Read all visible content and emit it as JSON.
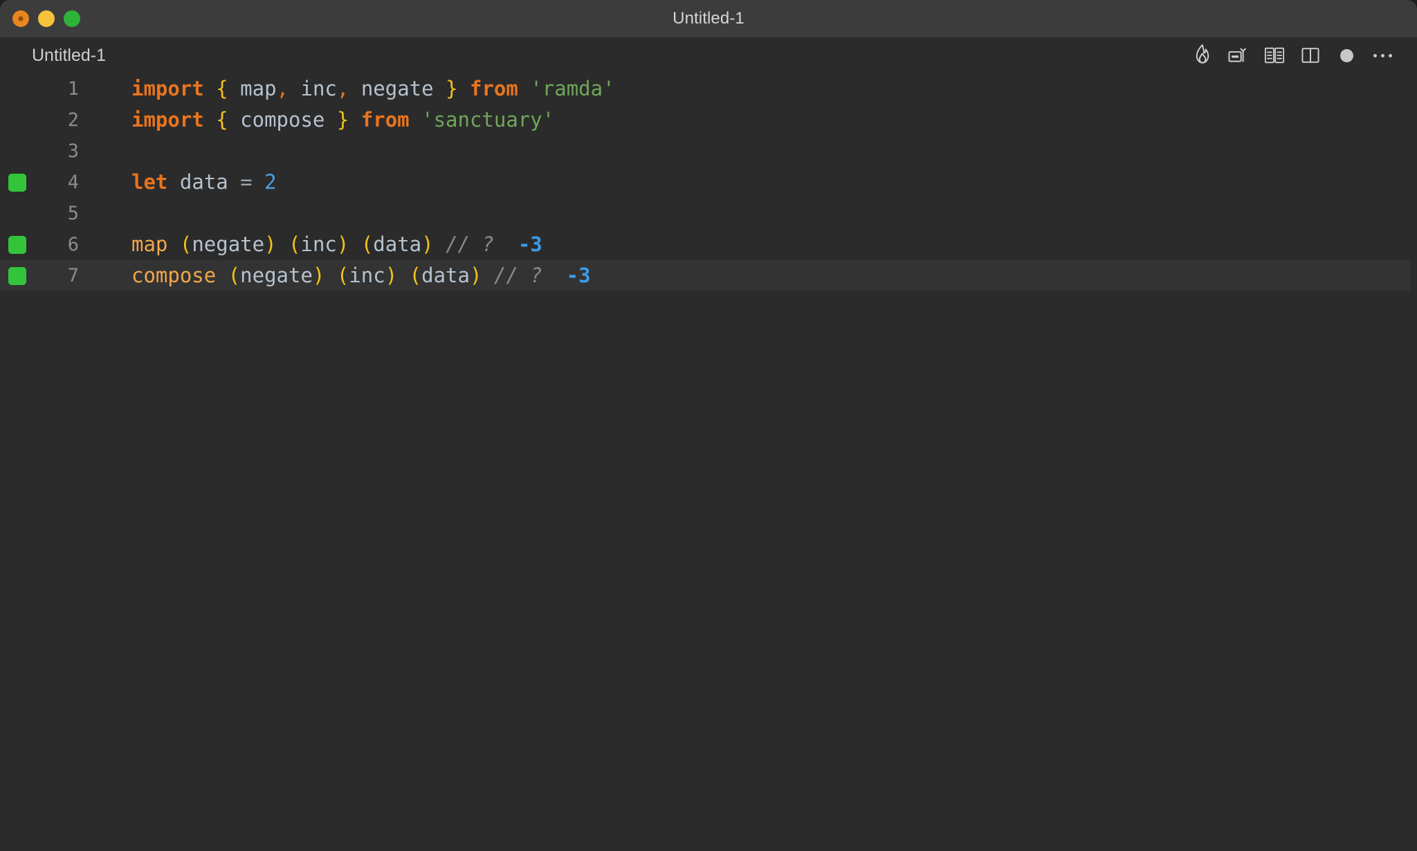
{
  "window": {
    "title": "Untitled-1",
    "traffic_lights": [
      {
        "name": "close",
        "color": "#e8861f"
      },
      {
        "name": "minimize",
        "color": "#f5c33b"
      },
      {
        "name": "maximize",
        "color": "#2eb339"
      }
    ]
  },
  "editor": {
    "tab_title": "Untitled-1",
    "background": "#2b2b2b",
    "active_line_background": "#333333",
    "toolbar": [
      {
        "name": "quokka-flame-icon",
        "label": "Start Quokka"
      },
      {
        "name": "run-code-lens-icon",
        "label": "Run Code"
      },
      {
        "name": "open-book-icon",
        "label": "Open Preview"
      },
      {
        "name": "split-editor-icon",
        "label": "Split Editor Right"
      },
      {
        "name": "unsaved-dot-icon",
        "label": "Unsaved Changes"
      },
      {
        "name": "more-actions-icon",
        "label": "More Actions..."
      }
    ],
    "coverage_marker_color": "#34c43c",
    "lines": [
      {
        "number": "1",
        "marker": false,
        "active": false,
        "tokens": [
          {
            "t": "import",
            "c": "tok-keyword"
          },
          {
            "t": " ",
            "c": "tok-plain"
          },
          {
            "t": "{",
            "c": "tok-brace"
          },
          {
            "t": " ",
            "c": "tok-plain"
          },
          {
            "t": "map",
            "c": "tok-ident"
          },
          {
            "t": ",",
            "c": "tok-punct"
          },
          {
            "t": " ",
            "c": "tok-plain"
          },
          {
            "t": "inc",
            "c": "tok-ident"
          },
          {
            "t": ",",
            "c": "tok-punct"
          },
          {
            "t": " ",
            "c": "tok-plain"
          },
          {
            "t": "negate",
            "c": "tok-ident"
          },
          {
            "t": " ",
            "c": "tok-plain"
          },
          {
            "t": "}",
            "c": "tok-brace"
          },
          {
            "t": " ",
            "c": "tok-plain"
          },
          {
            "t": "from",
            "c": "tok-keyword"
          },
          {
            "t": " ",
            "c": "tok-plain"
          },
          {
            "t": "'ramda'",
            "c": "tok-string"
          }
        ]
      },
      {
        "number": "2",
        "marker": false,
        "active": false,
        "tokens": [
          {
            "t": "import",
            "c": "tok-keyword"
          },
          {
            "t": " ",
            "c": "tok-plain"
          },
          {
            "t": "{",
            "c": "tok-brace"
          },
          {
            "t": " ",
            "c": "tok-plain"
          },
          {
            "t": "compose",
            "c": "tok-ident"
          },
          {
            "t": " ",
            "c": "tok-plain"
          },
          {
            "t": "}",
            "c": "tok-brace"
          },
          {
            "t": " ",
            "c": "tok-plain"
          },
          {
            "t": "from",
            "c": "tok-keyword"
          },
          {
            "t": " ",
            "c": "tok-plain"
          },
          {
            "t": "'sanctuary'",
            "c": "tok-string"
          }
        ]
      },
      {
        "number": "3",
        "marker": false,
        "active": false,
        "tokens": []
      },
      {
        "number": "4",
        "marker": true,
        "active": false,
        "tokens": [
          {
            "t": "let",
            "c": "tok-keyword"
          },
          {
            "t": " ",
            "c": "tok-plain"
          },
          {
            "t": "data",
            "c": "tok-ident"
          },
          {
            "t": " ",
            "c": "tok-plain"
          },
          {
            "t": "=",
            "c": "tok-op"
          },
          {
            "t": " ",
            "c": "tok-plain"
          },
          {
            "t": "2",
            "c": "tok-number"
          }
        ]
      },
      {
        "number": "5",
        "marker": false,
        "active": false,
        "tokens": []
      },
      {
        "number": "6",
        "marker": true,
        "active": false,
        "tokens": [
          {
            "t": "map",
            "c": "tok-func"
          },
          {
            "t": " ",
            "c": "tok-plain"
          },
          {
            "t": "(",
            "c": "tok-paren"
          },
          {
            "t": "negate",
            "c": "tok-ident"
          },
          {
            "t": ")",
            "c": "tok-paren"
          },
          {
            "t": " ",
            "c": "tok-plain"
          },
          {
            "t": "(",
            "c": "tok-paren"
          },
          {
            "t": "inc",
            "c": "tok-ident"
          },
          {
            "t": ")",
            "c": "tok-paren"
          },
          {
            "t": " ",
            "c": "tok-plain"
          },
          {
            "t": "(",
            "c": "tok-paren"
          },
          {
            "t": "data",
            "c": "tok-ident"
          },
          {
            "t": ")",
            "c": "tok-paren"
          },
          {
            "t": " ",
            "c": "tok-plain"
          },
          {
            "t": "// ?",
            "c": "tok-comment"
          },
          {
            "t": "  ",
            "c": "tok-plain"
          },
          {
            "t": "-3",
            "c": "tok-value"
          }
        ]
      },
      {
        "number": "7",
        "marker": true,
        "active": true,
        "tokens": [
          {
            "t": "compose",
            "c": "tok-func"
          },
          {
            "t": " ",
            "c": "tok-plain"
          },
          {
            "t": "(",
            "c": "tok-paren"
          },
          {
            "t": "negate",
            "c": "tok-ident"
          },
          {
            "t": ")",
            "c": "tok-paren"
          },
          {
            "t": " ",
            "c": "tok-plain"
          },
          {
            "t": "(",
            "c": "tok-paren"
          },
          {
            "t": "inc",
            "c": "tok-ident"
          },
          {
            "t": ")",
            "c": "tok-paren"
          },
          {
            "t": " ",
            "c": "tok-plain"
          },
          {
            "t": "(",
            "c": "tok-paren"
          },
          {
            "t": "data",
            "c": "tok-ident"
          },
          {
            "t": ")",
            "c": "tok-paren"
          },
          {
            "t": " ",
            "c": "tok-plain"
          },
          {
            "t": "// ?",
            "c": "tok-comment"
          },
          {
            "t": "  ",
            "c": "tok-plain"
          },
          {
            "t": "-3",
            "c": "tok-value"
          }
        ]
      }
    ]
  }
}
